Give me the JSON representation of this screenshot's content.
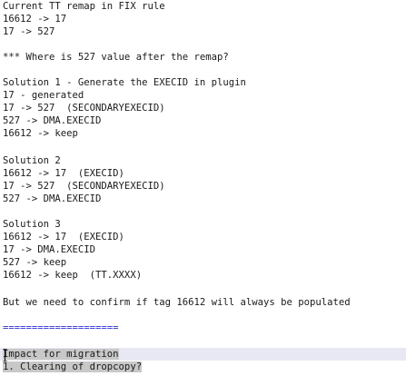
{
  "document": {
    "lines": [
      "Current TT remap in FIX rule",
      "16612 -> 17",
      "17 -> 527",
      "",
      "*** Where is 527 value after the remap?",
      "",
      "Solution 1 - Generate the EXECID in plugin",
      "17 - generated",
      "17 -> 527  (SECONDARYEXECID)",
      "527 -> DMA.EXECID",
      "16612 -> keep",
      "",
      "Solution 2",
      "16612 -> 17  (EXECID)",
      "17 -> 527  (SECONDARYEXECID)",
      "527 -> DMA.EXECID",
      "",
      "Solution 3",
      "16612 -> 17  (EXECID)",
      "17 -> DMA.EXECID",
      "527 -> keep",
      "16612 -> keep  (TT.XXXX)",
      "",
      "But we need to confirm if tag 16612 will always be populated",
      "",
      "====================",
      "",
      "Impact for migration",
      "1. Clearing of dropcopy?"
    ]
  }
}
